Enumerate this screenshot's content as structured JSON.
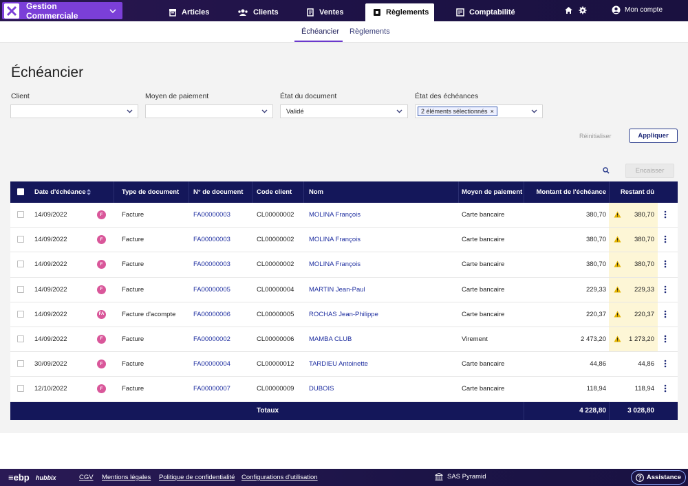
{
  "app": {
    "name": "Gestion Commerciale",
    "logo_letter": "X"
  },
  "nav": {
    "tabs": [
      {
        "label": "Articles",
        "icon": "archive-icon"
      },
      {
        "label": "Clients",
        "icon": "users-icon"
      },
      {
        "label": "Ventes",
        "icon": "document-icon"
      },
      {
        "label": "Règlements",
        "icon": "payment-icon",
        "active": true
      },
      {
        "label": "Comptabilité",
        "icon": "ledger-icon"
      }
    ],
    "account_label": "Mon compte"
  },
  "subtabs": [
    {
      "label": "Échéancier",
      "active": true
    },
    {
      "label": "Règlements",
      "active": false
    }
  ],
  "page": {
    "title": "Échéancier"
  },
  "filters": {
    "client": {
      "label": "Client",
      "value": ""
    },
    "moyen": {
      "label": "Moyen de paiement",
      "value": ""
    },
    "etat_doc": {
      "label": "État du document",
      "value": "Validé"
    },
    "etat_ech": {
      "label": "État des échéances",
      "chip": "2 éléments sélectionnés",
      "chip_remove": "×"
    }
  },
  "actions": {
    "reset": "Réinitialiser",
    "apply": "Appliquer",
    "encaisser": "Encaisser"
  },
  "table": {
    "headers": {
      "date": "Date d'échéance",
      "type": "Type de document",
      "num": "N° de document",
      "code": "Code client",
      "nom": "Nom",
      "moyen": "Moyen de paiement",
      "montant": "Montant de l'échéance",
      "restant": "Restant dû"
    },
    "rows": [
      {
        "date": "14/09/2022",
        "badge": "F",
        "type": "Facture",
        "num": "FA00000003",
        "code": "CL00000002",
        "nom": "MOLINA François",
        "moyen": "Carte bancaire",
        "montant": "380,70",
        "restant": "380,70",
        "warning": true
      },
      {
        "date": "14/09/2022",
        "badge": "F",
        "type": "Facture",
        "num": "FA00000003",
        "code": "CL00000002",
        "nom": "MOLINA François",
        "moyen": "Carte bancaire",
        "montant": "380,70",
        "restant": "380,70",
        "warning": true
      },
      {
        "date": "14/09/2022",
        "badge": "F",
        "type": "Facture",
        "num": "FA00000003",
        "code": "CL00000002",
        "nom": "MOLINA François",
        "moyen": "Carte bancaire",
        "montant": "380,70",
        "restant": "380,70",
        "warning": true
      },
      {
        "date": "14/09/2022",
        "badge": "F",
        "type": "Facture",
        "num": "FA00000005",
        "code": "CL00000004",
        "nom": "MARTIN Jean-Paul",
        "moyen": "Carte bancaire",
        "montant": "229,33",
        "restant": "229,33",
        "warning": true
      },
      {
        "date": "14/09/2022",
        "badge": "FA",
        "type": "Facture d'acompte",
        "num": "FA00000006",
        "code": "CL00000005",
        "nom": "ROCHAS Jean-Philippe",
        "moyen": "Carte bancaire",
        "montant": "220,37",
        "restant": "220,37",
        "warning": true
      },
      {
        "date": "14/09/2022",
        "badge": "F",
        "type": "Facture",
        "num": "FA00000002",
        "code": "CL00000006",
        "nom": "MAMBA CLUB",
        "moyen": "Virement",
        "montant": "2 473,20",
        "restant": "1 273,20",
        "warning": true
      },
      {
        "date": "30/09/2022",
        "badge": "F",
        "type": "Facture",
        "num": "FA00000004",
        "code": "CL00000012",
        "nom": "TARDIEU Antoinette",
        "moyen": "Carte bancaire",
        "montant": "44,86",
        "restant": "44,86",
        "warning": false
      },
      {
        "date": "12/10/2022",
        "badge": "F",
        "type": "Facture",
        "num": "FA00000007",
        "code": "CL00000009",
        "nom": "DUBOIS",
        "moyen": "Carte bancaire",
        "montant": "118,94",
        "restant": "118,94",
        "warning": false
      }
    ],
    "totals": {
      "label": "Totaux",
      "montant": "4 228,80",
      "restant": "3 028,80"
    }
  },
  "footer": {
    "brand": "≡ebp",
    "brand_sub": "hubbix",
    "links": [
      "CGV",
      "Mentions légales",
      "Politique de confidentialité",
      "Configurations d'utilisation"
    ],
    "company": "SAS Pyramid",
    "assist": "Assistance"
  },
  "colors": {
    "header_bg": "#14175a",
    "accent": "#7b3fd8",
    "link": "#1f2fa0",
    "warning_bg": "#fdf6d6",
    "badge": "#d9579a"
  }
}
